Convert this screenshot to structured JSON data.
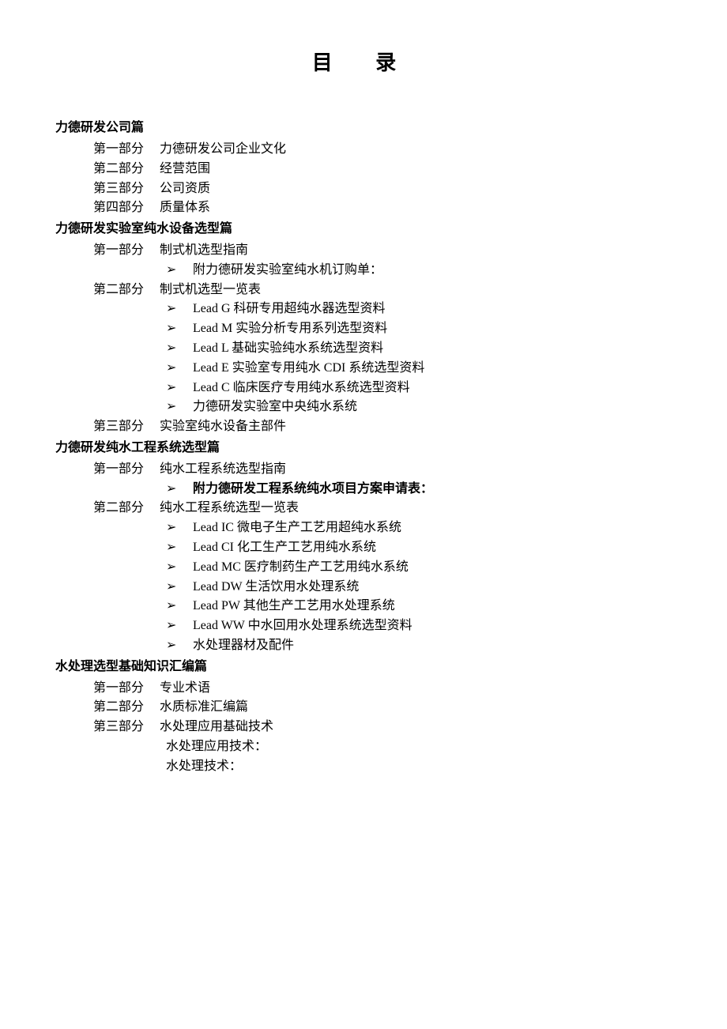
{
  "title": "目 录",
  "sections": [
    {
      "heading": "力德研发公司篇",
      "parts": [
        {
          "label": "第一部分",
          "title": "力德研发公司企业文化"
        },
        {
          "label": "第二部分",
          "title": "经营范围"
        },
        {
          "label": "第三部分",
          "title": "公司资质"
        },
        {
          "label": "第四部分",
          "title": "质量体系"
        }
      ]
    },
    {
      "heading": "力德研发实验室纯水设备选型篇",
      "parts": [
        {
          "label": "第一部分",
          "title": "制式机选型指南",
          "bullets": [
            {
              "text": "附力德研发实验室纯水机订购单：",
              "bold": false
            }
          ]
        },
        {
          "label": "第二部分",
          "title": "制式机选型一览表",
          "bullets": [
            {
              "text": "Lead G 科研专用超纯水器选型资料"
            },
            {
              "text": "Lead M 实验分析专用系列选型资料"
            },
            {
              "text": "Lead L 基础实验纯水系统选型资料"
            },
            {
              "text": "Lead E 实验室专用纯水 CDI 系统选型资料"
            },
            {
              "text": "Lead C 临床医疗专用纯水系统选型资料"
            },
            {
              "text": "力德研发实验室中央纯水系统"
            }
          ]
        },
        {
          "label": "第三部分",
          "title": "实验室纯水设备主部件"
        }
      ]
    },
    {
      "heading": "力德研发纯水工程系统选型篇",
      "parts": [
        {
          "label": "第一部分",
          "title": "纯水工程系统选型指南",
          "bullets": [
            {
              "text": "附力德研发工程系统纯水项目方案申请表：",
              "bold": true
            }
          ]
        },
        {
          "label": "第二部分",
          "title": "纯水工程系统选型一览表",
          "bullets": [
            {
              "text": "Lead IC 微电子生产工艺用超纯水系统"
            },
            {
              "text": "Lead CI 化工生产工艺用纯水系统"
            },
            {
              "text": "Lead MC 医疗制药生产工艺用纯水系统"
            },
            {
              "text": "Lead DW 生活饮用水处理系统"
            },
            {
              "text": "Lead PW 其他生产工艺用水处理系统"
            },
            {
              "text": "Lead WW  中水回用水处理系统选型资料"
            },
            {
              "text": "水处理器材及配件"
            }
          ]
        }
      ]
    },
    {
      "heading": "水处理选型基础知识汇编篇",
      "parts": [
        {
          "label": "第一部分",
          "title": "专业术语"
        },
        {
          "label": "第二部分",
          "title": "水质标准汇编篇"
        },
        {
          "label": "第三部分",
          "title": "水处理应用基础技术",
          "sublines": [
            "水处理应用技术：",
            "水处理技术："
          ]
        }
      ]
    }
  ]
}
